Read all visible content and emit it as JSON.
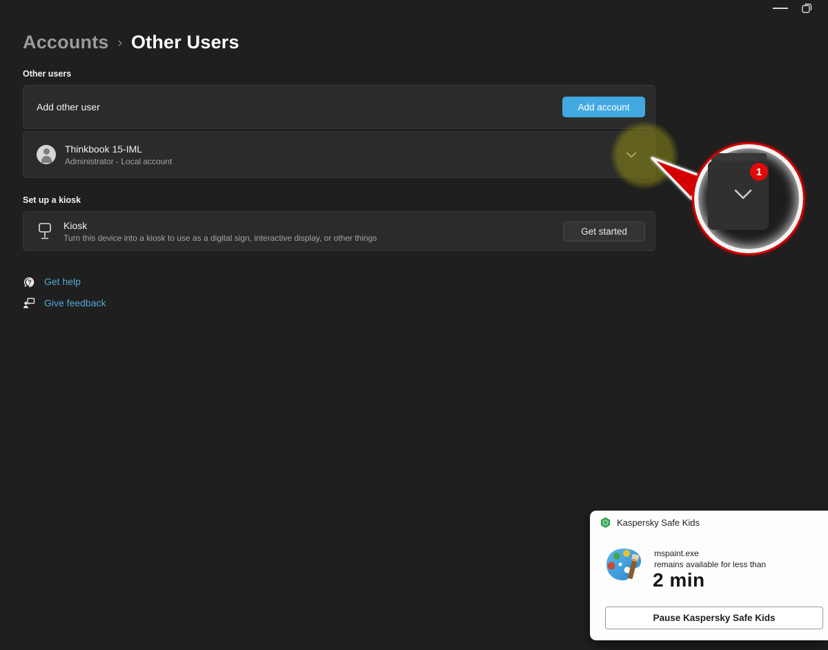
{
  "titlebar": {
    "minimize_icon": "minimize",
    "restore_icon": "restore-window"
  },
  "breadcrumb": {
    "parent": "Accounts",
    "separator": "›",
    "current": "Other Users"
  },
  "other_users_section": {
    "label": "Other users",
    "add_row": {
      "title": "Add other user",
      "button_label": "Add account"
    },
    "user_row": {
      "name": "Thinkbook 15-IML",
      "description": "Administrator - Local account"
    }
  },
  "kiosk_section": {
    "label": "Set up a kiosk",
    "row": {
      "title": "Kiosk",
      "description": "Turn this device into a kiosk to use as a digital sign, interactive display, or other things",
      "button_label": "Get started"
    }
  },
  "footer_links": {
    "get_help": "Get help",
    "give_feedback": "Give feedback"
  },
  "annotation": {
    "step_badge": "1"
  },
  "notification": {
    "app_name": "Kaspersky Safe Kids",
    "process_name": "mspaint.exe",
    "message_line": "remains available for less than",
    "time_remaining": "2 min",
    "action_button": "Pause Kaspersky Safe Kids"
  },
  "colors": {
    "page_background": "#1f1f1f",
    "card_background": "#2b2b2b",
    "accent_button": "#42a9e0",
    "link": "#53a9d8",
    "annotation_red": "#d40000",
    "highlight_yellow": "#96941a",
    "notification_background": "#fdfdfd"
  }
}
